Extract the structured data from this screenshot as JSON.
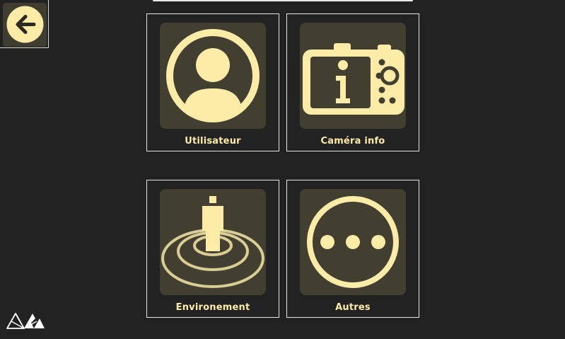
{
  "toolbar": {
    "back_icon": "arrow-left-icon"
  },
  "tiles": [
    {
      "label": "Utilisateur",
      "icon": "user-icon"
    },
    {
      "label": "Caméra info",
      "icon": "camera-info-icon"
    },
    {
      "label": "Environement",
      "icon": "environment-person-icon"
    },
    {
      "label": "Autres",
      "icon": "more-dots-icon"
    }
  ],
  "colors": {
    "background": "#222222",
    "tile_bg": "#423f31",
    "accent": "#fdeba8",
    "border": "#e6e6e6"
  },
  "footer": {
    "logo_icon": "brand-logo-icon"
  }
}
